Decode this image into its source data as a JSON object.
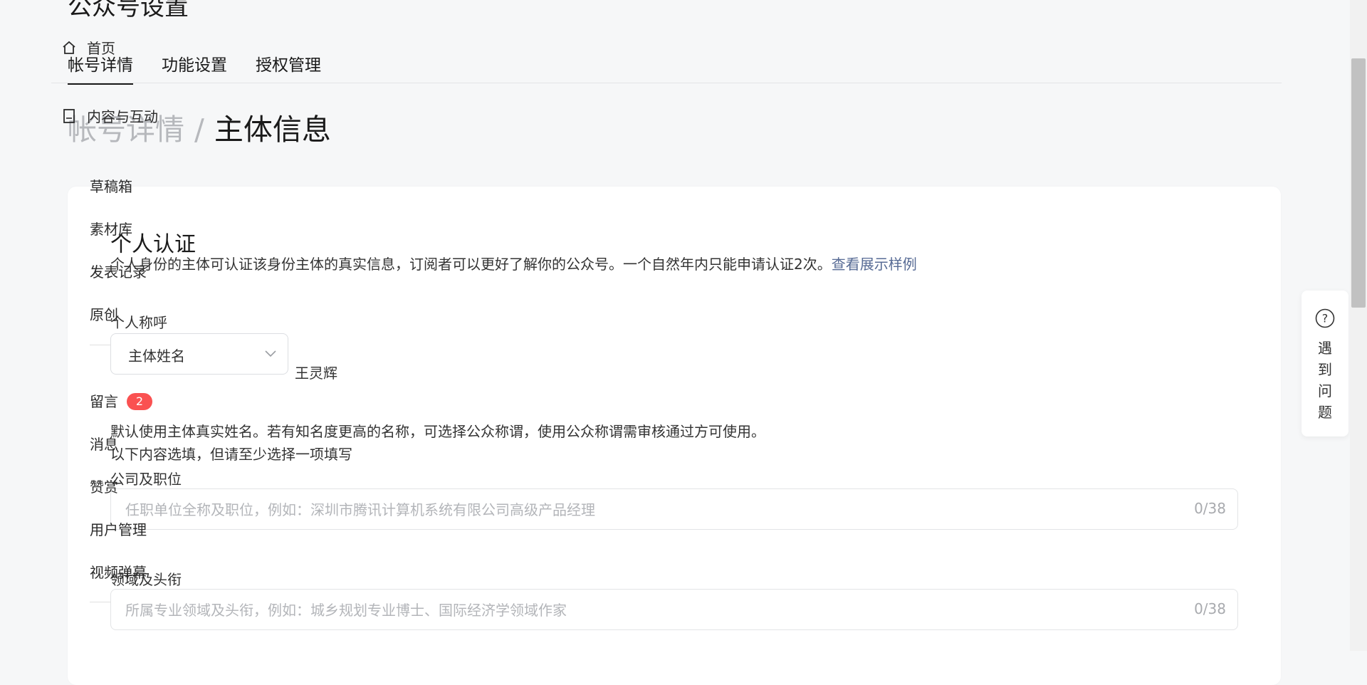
{
  "page": {
    "title": "公众号设置",
    "tabs": [
      {
        "label": "帐号详情"
      },
      {
        "label": "功能设置"
      },
      {
        "label": "授权管理"
      }
    ],
    "breadcrumb": {
      "parent": "帐号详情",
      "separator": "/",
      "current": "主体信息"
    }
  },
  "sidebar": {
    "items": [
      {
        "label": "首页",
        "icon": "home-icon"
      },
      {
        "label": "内容与互动",
        "icon": "document-icon"
      },
      {
        "label": "草稿箱"
      },
      {
        "label": "素材库"
      },
      {
        "label": "发表记录"
      },
      {
        "label": "原创"
      },
      {
        "label": "留言",
        "badge": "2"
      },
      {
        "label": "消息"
      },
      {
        "label": "赞赏"
      },
      {
        "label": "用户管理"
      },
      {
        "label": "视频弹幕"
      }
    ]
  },
  "section": {
    "title": "个人认证",
    "description": "个人身份的主体可认证该身份主体的真实信息，订阅者可以更好了解你的公众号。一个自然年内只能申请认证2次。",
    "sample_link": "查看展示样例",
    "name_label": "个人称呼",
    "name_select": {
      "value": "主体姓名"
    },
    "real_name": "王灵辉",
    "name_hint": "默认使用主体真实姓名。若有知名度更高的名称，可选择公众称谓，使用公众称谓需审核通过方可使用。",
    "optional_note": "以下内容选填，但请至少选择一项填写",
    "company_label": "公司及职位",
    "company_input": {
      "placeholder": "任职单位全称及职位，例如：深圳市腾讯计算机系统有限公司高级产品经理",
      "value": "",
      "count": "0/38"
    },
    "field_label": "领域及头衔",
    "field_input": {
      "placeholder": "所属专业领域及头衔，例如：城乡规划专业博士、国际经济学领域作家",
      "value": "",
      "count": "0/38"
    }
  },
  "help": {
    "label": "遇到问题"
  },
  "colors": {
    "accent_link": "#576b95",
    "badge": "#fa5151",
    "background": "#f6f7f8"
  }
}
